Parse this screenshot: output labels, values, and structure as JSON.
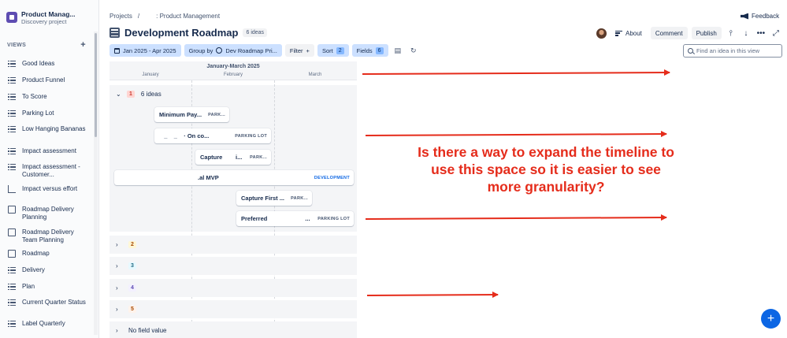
{
  "project": {
    "name": "Product Manag...",
    "type": "Discovery project"
  },
  "sidebar": {
    "views_label": "VIEWS",
    "add_label": "+",
    "items": [
      {
        "label": "Good Ideas",
        "icon": "list-icon"
      },
      {
        "label": "Product Funnel",
        "icon": "list-icon"
      },
      {
        "label": "To Score",
        "icon": "list-icon"
      },
      {
        "label": "Parking Lot",
        "icon": "list-icon"
      },
      {
        "label": "Low Hanging Bananas",
        "icon": "list-icon"
      },
      {
        "label": "Impact assessment",
        "icon": "list-icon"
      },
      {
        "label": "Impact assessment - Customer...",
        "icon": "list-icon"
      },
      {
        "label": "Impact versus effort",
        "icon": "matrix-icon"
      },
      {
        "label": "Roadmap Delivery Planning",
        "icon": "board-icon"
      },
      {
        "label": "Roadmap Delivery Team Planning",
        "icon": "board-icon"
      },
      {
        "label": "Roadmap",
        "icon": "board-icon"
      },
      {
        "label": "Delivery",
        "icon": "list-icon"
      },
      {
        "label": "Plan",
        "icon": "timeline-icon"
      },
      {
        "label": "Current Quarter Status",
        "icon": "timeline-icon"
      },
      {
        "label": "Label Quarterly",
        "icon": "list-icon"
      }
    ]
  },
  "header": {
    "breadcrumb": [
      "Projects",
      "/",
      ": Product Management"
    ],
    "feedback": "Feedback",
    "title": "Development Roadmap",
    "idea_count": "6 ideas",
    "about": "About",
    "comment": "Comment",
    "publish": "Publish"
  },
  "toolbar": {
    "date_range": "Jan 2025 - Apr 2025",
    "group_by": "Group by",
    "group_field": "Dev Roadmap Pri...",
    "filter": "Filter",
    "filter_plus": "+",
    "sort": "Sort",
    "sort_count": "2",
    "fields": "Fields",
    "fields_count": "6",
    "search_placeholder": "Find an idea in this view"
  },
  "timeline": {
    "quarter": "January-March 2025",
    "months": [
      "January",
      "February",
      "March"
    ],
    "group_open": {
      "number": "1",
      "count_label": "6 ideas",
      "color": "#c9372c",
      "bg": "#ffd5d2"
    },
    "bars": [
      {
        "name": "Minimum Pay...",
        "tag": "PARK..."
      },
      {
        "name": "   _    _    · On co...",
        "tag": "PARKING LOT"
      },
      {
        "name": "Capture        i...",
        "tag": "PARK..."
      },
      {
        "name": "                                                .al MVP",
        "tag": "DEVELOPMENT"
      },
      {
        "name": "Capture First ...",
        "tag": "PARK..."
      },
      {
        "name": "Preferred                       ...",
        "tag": "PARKING LOT"
      }
    ],
    "collapsed_groups": [
      {
        "label": "2",
        "color": "#a54800",
        "bg": "#fff7d6"
      },
      {
        "label": "3",
        "color": "#206a83",
        "bg": "#e7f9ff"
      },
      {
        "label": "4",
        "color": "#5e4db2",
        "bg": "#f3f0ff"
      },
      {
        "label": "5",
        "color": "#a54800",
        "bg": "#fff3eb"
      },
      {
        "label": "No field value",
        "color": "#172b4d",
        "bg": "transparent"
      }
    ]
  },
  "annotation": {
    "text": "Is there a way to expand the timeline to use this space so it is easier to see more granularity?",
    "color": "#e52c1b"
  },
  "colors": {
    "accent": "#0c66e4",
    "selected": "#cce0ff",
    "project_logo": "#5e4db2"
  }
}
